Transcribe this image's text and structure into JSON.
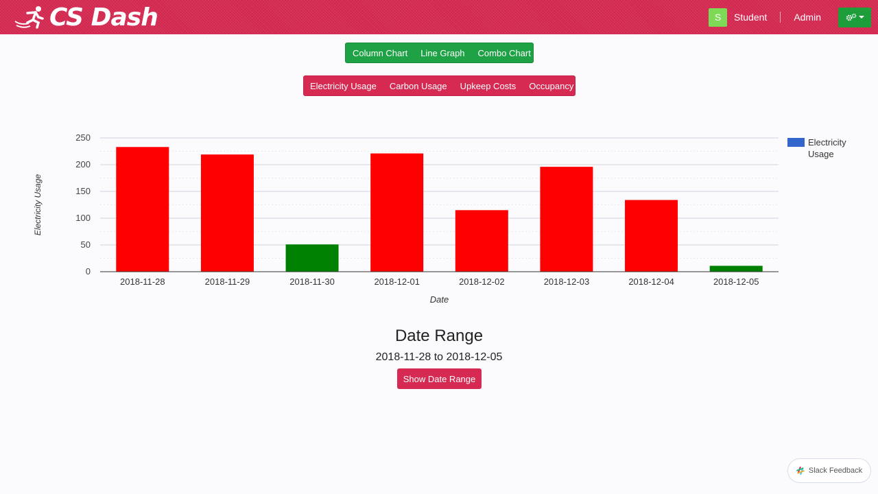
{
  "navbar": {
    "brand": "CS Dash",
    "avatar_letter": "S",
    "links": [
      "Student",
      "Admin"
    ],
    "settings_icon": "gears-icon"
  },
  "chart_type_buttons": [
    "Column Chart",
    "Line Graph",
    "Combo Chart"
  ],
  "metric_buttons": [
    "Electricity Usage",
    "Carbon Usage",
    "Upkeep Costs",
    "Occupancy"
  ],
  "chart_data": {
    "type": "bar",
    "categories": [
      "2018-11-28",
      "2018-11-29",
      "2018-11-30",
      "2018-12-01",
      "2018-12-02",
      "2018-12-03",
      "2018-12-04",
      "2018-12-05"
    ],
    "values": [
      233,
      219,
      51,
      221,
      115,
      196,
      134,
      11
    ],
    "bar_colors": [
      "#ff0000",
      "#ff0000",
      "#008000",
      "#ff0000",
      "#ff0000",
      "#ff0000",
      "#ff0000",
      "#008000"
    ],
    "series": [
      {
        "name": "Electricity Usage",
        "legend_color": "#3366cc"
      }
    ],
    "legend_lines": [
      "Electricity",
      "Usage"
    ],
    "legend_position": "right",
    "xlabel": "Date",
    "ylabel": "Electricity Usage",
    "ylim": [
      0,
      250
    ],
    "yticks": [
      "0",
      "50",
      "100",
      "150",
      "200",
      "250"
    ],
    "grid": true
  },
  "date_range": {
    "title": "Date Range",
    "value": "2018-11-28 to 2018-12-05",
    "button": "Show Date Range"
  },
  "feedback": {
    "label": "Slack Feedback",
    "icon": "slack-icon"
  }
}
